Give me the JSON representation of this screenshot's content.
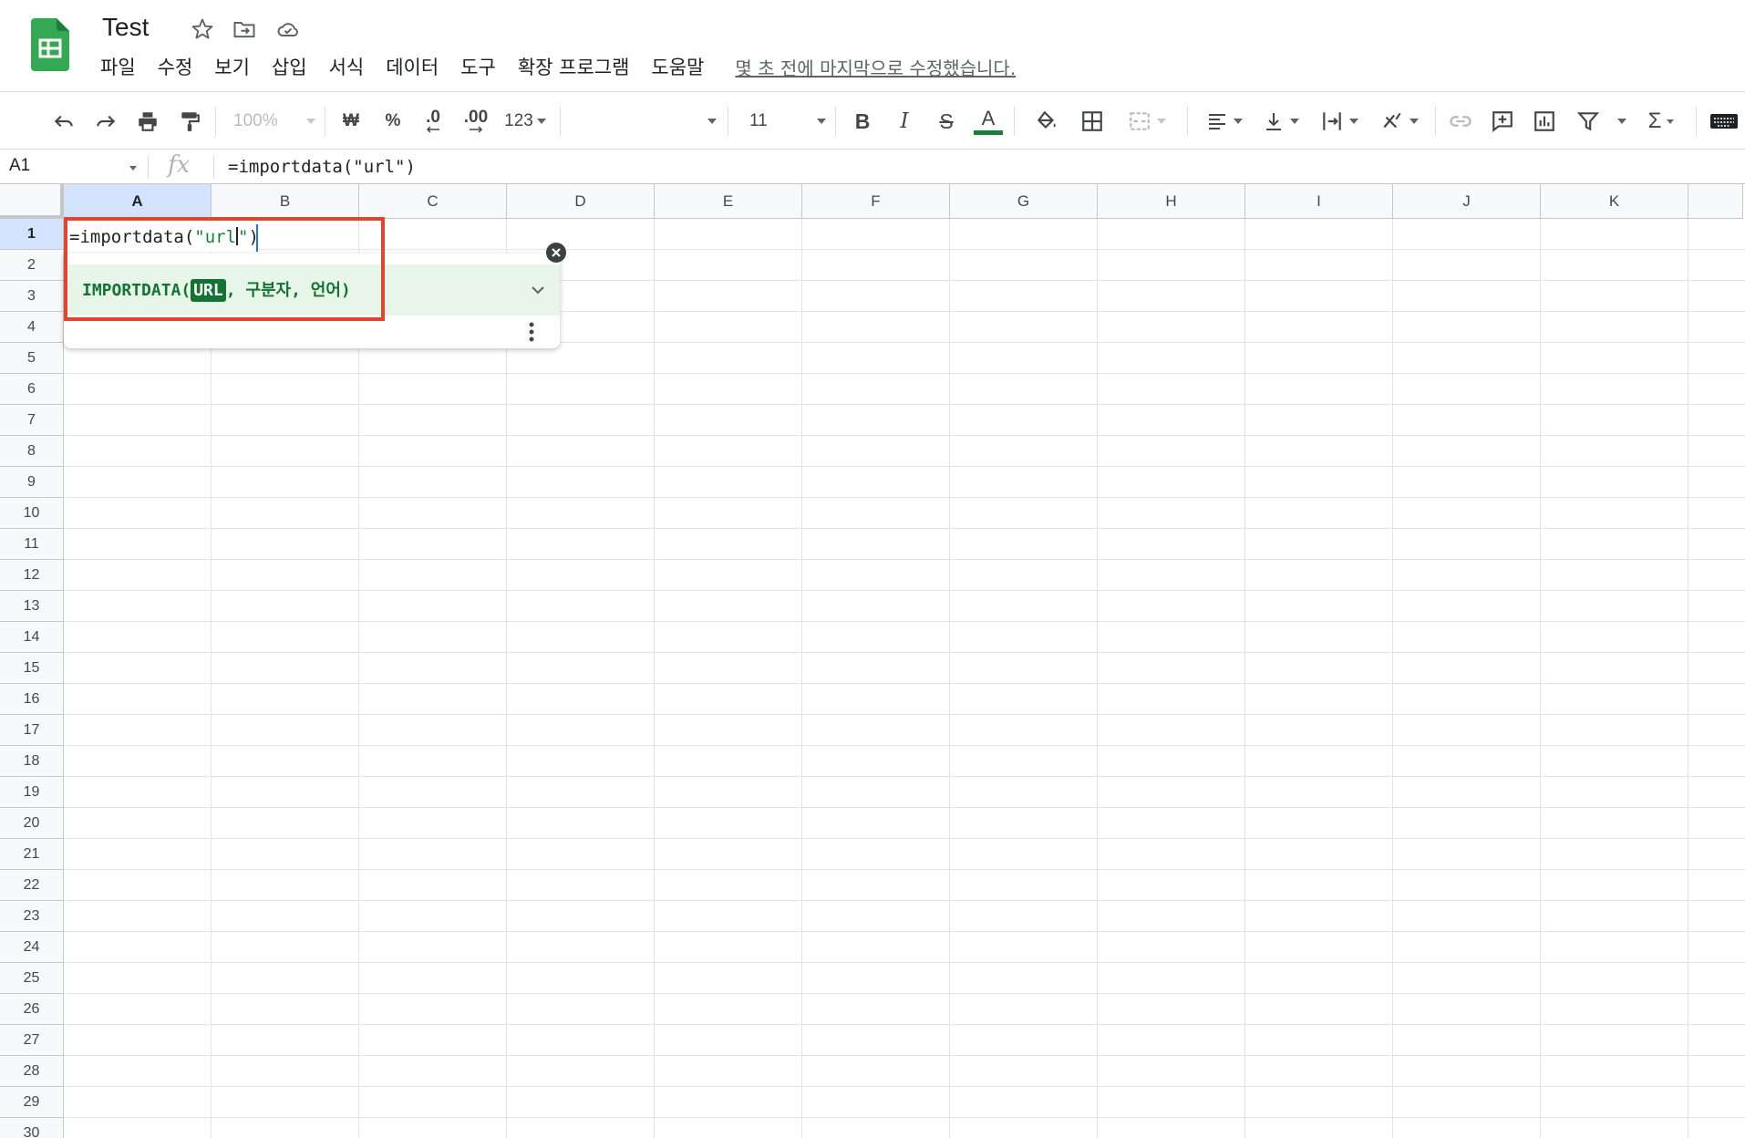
{
  "app": {
    "title": "Test",
    "menu": [
      "파일",
      "수정",
      "보기",
      "삽입",
      "서식",
      "데이터",
      "도구",
      "확장 프로그램",
      "도움말"
    ],
    "last_edit": "몇 초 전에 마지막으로 수정했습니다."
  },
  "toolbar": {
    "zoom": "100%",
    "currency_label": "₩",
    "percent_label": "%",
    "decrease_decimal_label": ".0",
    "increase_decimal_label": ".00",
    "more_formats_label": "123",
    "font_size": "11",
    "bold_label": "B",
    "italic_label": "I",
    "strike_label": "S",
    "text_color_label": "A",
    "text_color": "#188038",
    "sum_label": "Σ"
  },
  "formula_bar": {
    "cell_ref": "A1",
    "fx_label": "fx",
    "formula": "=importdata(\"url\")"
  },
  "grid": {
    "columns": [
      "A",
      "B",
      "C",
      "D",
      "E",
      "F",
      "G",
      "H",
      "I",
      "J",
      "K"
    ],
    "rows": [
      "1",
      "2",
      "3",
      "4",
      "5",
      "6",
      "7",
      "8",
      "9",
      "10",
      "11",
      "12",
      "13",
      "14",
      "15",
      "16",
      "17",
      "18",
      "19",
      "20",
      "21",
      "22",
      "23",
      "24",
      "25",
      "26",
      "27",
      "28",
      "29",
      "30"
    ],
    "active_cell": "A1"
  },
  "editor": {
    "prefix": "=importdata(",
    "string_before_cursor": "\"url",
    "string_after_cursor": "\"",
    "suffix": ")"
  },
  "autocomplete": {
    "function_name": "IMPORTDATA(",
    "active_param": "URL",
    "rest": ", 구분자, 언어)"
  },
  "colors": {
    "accent": "#1a73e8",
    "brand": "#34a853",
    "highlight_box": "#e0452f",
    "autocomplete_bg": "#e8f5e9",
    "autocomplete_text": "#137333"
  }
}
